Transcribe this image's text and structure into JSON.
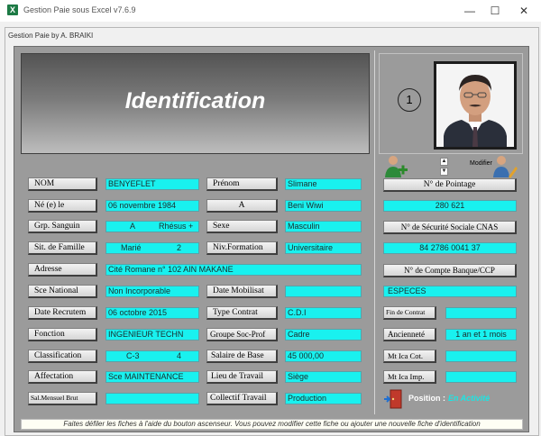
{
  "window": {
    "title": "Gestion Paie sous Excel v7.6.9",
    "app_icon": "X",
    "minimize": "—",
    "maximize": "☐",
    "close": "✕"
  },
  "form": {
    "title": "Gestion Paie by A. BRAIKI",
    "header": "Identification",
    "record_number": "1",
    "modifier_label": "Modifier"
  },
  "fields": {
    "nom": {
      "label": "NOM",
      "value": "BENYEFLET"
    },
    "prenom": {
      "label": "Prénom",
      "value": "Slimane"
    },
    "ne_le": {
      "label": "Né (e)  le",
      "value": "06 novembre 1984"
    },
    "lieu_naissance": {
      "label": "A",
      "value": "Beni Wiwi"
    },
    "grp_sanguin": {
      "label": "Grp. Sanguin",
      "group": "A",
      "rhesus": "Rhésus  +"
    },
    "sexe": {
      "label": "Sexe",
      "value": "Masculin"
    },
    "sit_famille": {
      "label": "Sit. de Famille",
      "value": "Marié",
      "enfants": "2"
    },
    "niv_formation": {
      "label": "Niv.Formation",
      "value": "Universitaire"
    },
    "adresse": {
      "label": "Adresse",
      "value": "Cité Romane n° 102  AIN MAKANE"
    },
    "sce_national": {
      "label": "Sce National",
      "value": "Non Incorporable"
    },
    "date_mobilisat": {
      "label": "Date Mobilisat",
      "value": ""
    },
    "date_recrutem": {
      "label": "Date Recrutem",
      "value": "06 octobre 2015"
    },
    "type_contrat": {
      "label": "Type Contrat",
      "value": "C.D.I"
    },
    "fonction": {
      "label": "Fonction",
      "value": "INGENIEUR TECHN"
    },
    "groupe_soc_prof": {
      "label": "Groupe Soc-Prof",
      "value": "Cadre"
    },
    "classification": {
      "label": "Classification",
      "class": "C-3",
      "echelon": "4"
    },
    "salaire_base": {
      "label": "Salaire de Base",
      "value": "45 000,00"
    },
    "affectation": {
      "label": "Affectation",
      "value": "Sce MAINTENANCE"
    },
    "lieu_travail": {
      "label": "Lieu de Travail",
      "value": "Siège"
    },
    "sal_mensuel_brut": {
      "label": "Sal.Mensuel Brut",
      "value": ""
    },
    "collectif_travail": {
      "label": "Collectif Travail",
      "value": "Production"
    }
  },
  "right": {
    "pointage": {
      "label": "N° de Pointage",
      "value": "280 621"
    },
    "securite_sociale": {
      "label": "N° de Sécurité Sociale CNAS",
      "value": "84   2786   0041  37"
    },
    "compte": {
      "label": "N° de Compte Banque/CCP",
      "value": "ESPECES"
    },
    "fin_contrat": {
      "label": "Fin de Contrat",
      "value": ""
    },
    "anciennete": {
      "label": "Ancienneté",
      "value": "1 an et 1 mois"
    },
    "mt_ica_cot": {
      "label": "Mt Ica Cot.",
      "value": ""
    },
    "mt_ica_imp": {
      "label": "Mt Ica Imp.",
      "value": ""
    },
    "position": {
      "label": "Position :",
      "value": "En Activité"
    }
  },
  "footer": "Faites défiler les fiches à l'aide du bouton ascenseur. Vous pouvez modifier cette fiche ou ajouter une nouvelle fiche d'identification",
  "colors": {
    "field": "#19f1ef",
    "panel": "#9b9b9b"
  }
}
